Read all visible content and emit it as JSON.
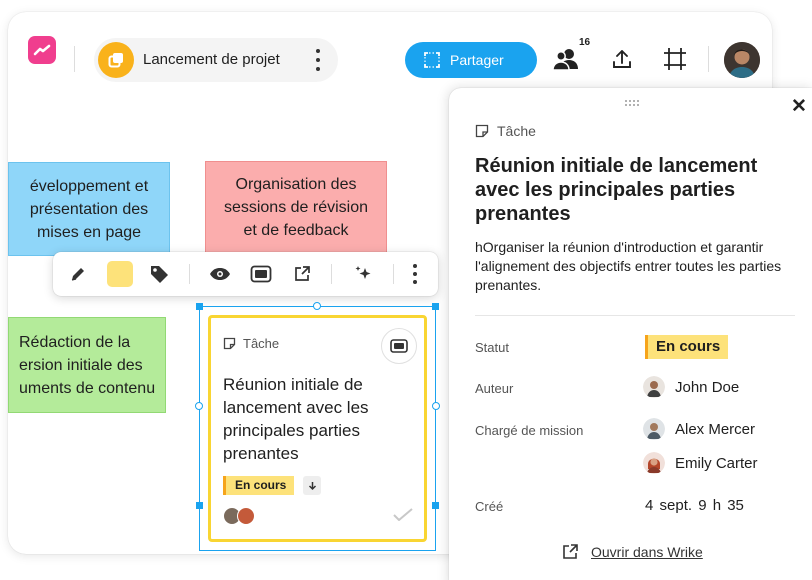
{
  "topbar": {
    "project_name": "Lancement de projet",
    "share_label": "Partager",
    "collaborators_count": "16"
  },
  "board": {
    "sticky_blue": [
      "éveloppement et",
      "présentation des",
      "mises en page"
    ],
    "sticky_pink": [
      "Organisation des",
      "sessions de révision",
      "et de feedback"
    ],
    "sticky_green": [
      "Rédaction de la",
      "ersion initiale des",
      "uments de contenu"
    ]
  },
  "task_card": {
    "type_label": "Tâche",
    "title": "Réunion initiale de lancement avec les principales parties prenantes",
    "status": "En cours"
  },
  "panel": {
    "type_label": "Tâche",
    "title": "Réunion initiale de lancement avec les principales parties prenantes",
    "description": "hOrganiser la réunion d'introduction et garantir l'alignement des objectifs entrer toutes les parties prenantes.",
    "status_label": "Statut",
    "status_value": "En cours",
    "author_label": "Auteur",
    "author": "John Doe",
    "assignee_label": "Chargé de mission",
    "assignees": [
      "Alex Mercer",
      "Emily Carter"
    ],
    "created_label": "Créé",
    "created_value": "4 sept.  9 h 35",
    "open_link": "Ouvrir dans Wrike"
  },
  "colors": {
    "share_blue": "#1aa3ef",
    "sticky_blue": "#8fd6f9",
    "sticky_pink": "#fbadad",
    "sticky_green": "#b4eb9a",
    "status_yellow": "#fde27a",
    "card_border_yellow": "#f9d532",
    "logo_pink": "#f03e8e",
    "project_icon_orange": "#f9b21b"
  },
  "icons": {
    "toolbar": [
      "pencil-icon",
      "color-swatch",
      "tag-icon",
      "eye-icon",
      "card-view-icon",
      "external-link-icon",
      "sparkle-icon",
      "more-vertical-icon"
    ],
    "topbar": [
      "app-logo-icon",
      "project-icon",
      "more-vertical-icon",
      "frame-icon",
      "users-icon",
      "upload-icon",
      "crop-frame-icon",
      "avatar"
    ]
  }
}
